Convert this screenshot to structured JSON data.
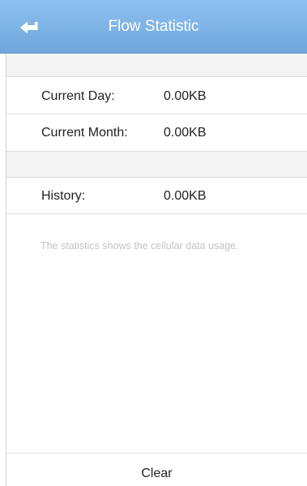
{
  "header": {
    "title": "Flow Statistic",
    "back_icon": "back-arrow-icon",
    "background": "#7fb3e6"
  },
  "stats": {
    "current_day": {
      "label": "Current Day:",
      "value": "0.00KB"
    },
    "current_month": {
      "label": "Current Month:",
      "value": "0.00KB"
    },
    "history": {
      "label": "History:",
      "value": "0.00KB"
    }
  },
  "note": "The statistics shows the cellular data usage.",
  "footer": {
    "clear_label": "Clear"
  }
}
